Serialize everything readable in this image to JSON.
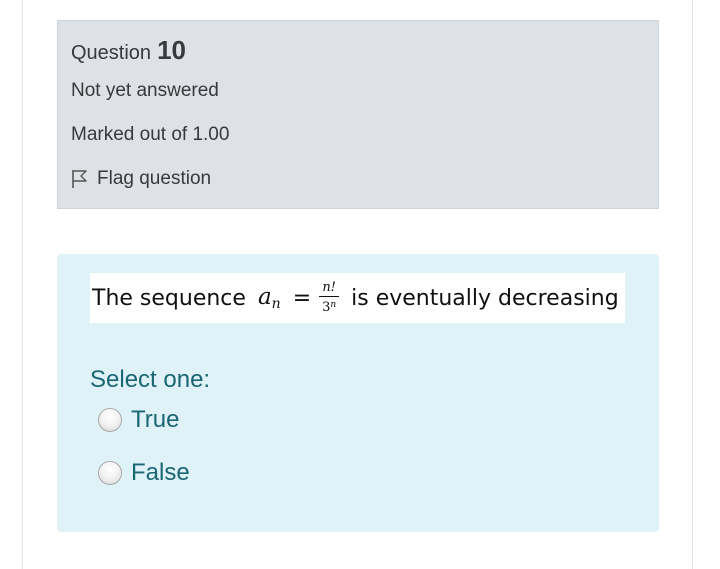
{
  "question_info": {
    "label": "Question",
    "number": "10",
    "state": "Not yet answered",
    "grade": "Marked out of 1.00",
    "flag_label": "Flag question",
    "flag_icon": "flag-outline-icon"
  },
  "question_text": {
    "prefix": "The sequence",
    "term_var": "a",
    "term_sub": "n",
    "equals": "=",
    "frac_num": "n!",
    "frac_den_base": "3",
    "frac_den_exp": "n",
    "suffix": "is eventually decreasing"
  },
  "answer": {
    "prompt": "Select one:",
    "options": [
      {
        "label": "True",
        "selected": false
      },
      {
        "label": "False",
        "selected": false
      }
    ]
  },
  "colors": {
    "info_bg": "#dee2e6",
    "content_bg": "#def2f8",
    "answer_text": "#1a6672"
  }
}
